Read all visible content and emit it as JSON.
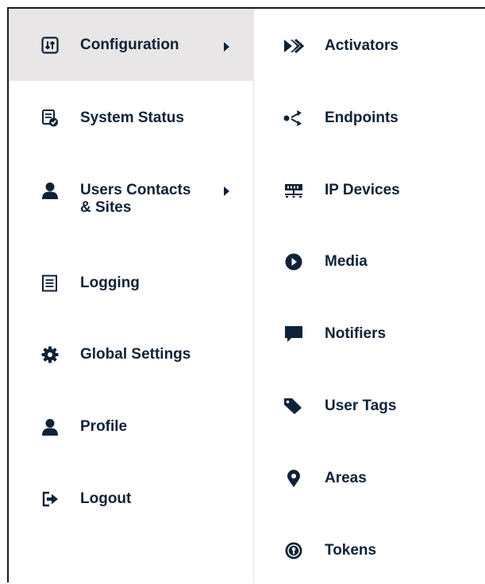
{
  "left_menu": {
    "items": [
      {
        "label": "Configuration",
        "icon": "sliders-icon",
        "has_submenu": true,
        "active": true
      },
      {
        "label": "System Status",
        "icon": "status-report-icon"
      },
      {
        "label": "Users Contacts\n& Sites",
        "icon": "user-icon",
        "has_submenu": true
      },
      {
        "label": "Logging",
        "icon": "list-icon"
      },
      {
        "label": "Global Settings",
        "icon": "gear-icon"
      },
      {
        "label": "Profile",
        "icon": "user-icon"
      },
      {
        "label": "Logout",
        "icon": "logout-icon"
      }
    ]
  },
  "submenu": {
    "items": [
      {
        "label": "Activators",
        "icon": "activator-icon"
      },
      {
        "label": "Endpoints",
        "icon": "endpoints-icon"
      },
      {
        "label": "IP Devices",
        "icon": "network-icon"
      },
      {
        "label": "Media",
        "icon": "play-icon"
      },
      {
        "label": "Notifiers",
        "icon": "chat-bubble-icon"
      },
      {
        "label": "User Tags",
        "icon": "tag-icon"
      },
      {
        "label": "Areas",
        "icon": "map-pin-icon"
      },
      {
        "label": "Tokens",
        "icon": "token-icon"
      }
    ]
  },
  "colors": {
    "text": "#0f2238",
    "active_bg": "#e8e6e6",
    "border": "#1a1a1a"
  }
}
